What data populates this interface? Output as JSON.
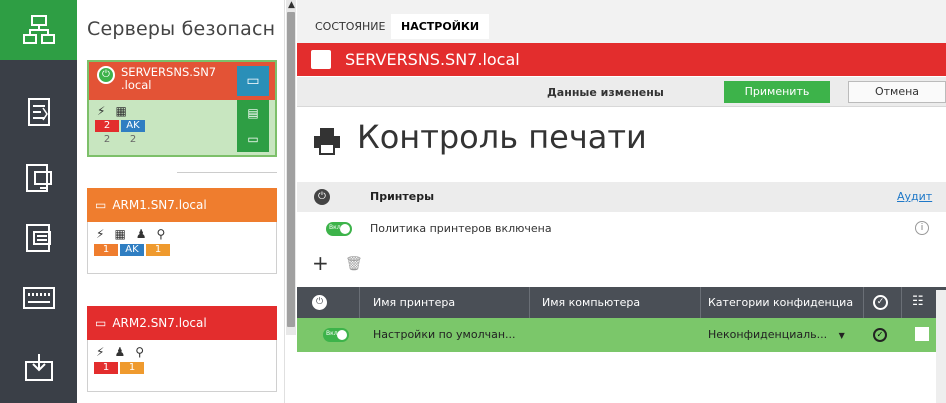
{
  "rail": {
    "items": [
      {
        "icon": "network-icon",
        "active": true
      },
      {
        "icon": "policy-icon",
        "active": false
      },
      {
        "icon": "devices-icon",
        "active": false
      },
      {
        "icon": "log-icon",
        "active": false
      },
      {
        "icon": "keyboard-icon",
        "active": false
      },
      {
        "icon": "install-icon",
        "active": false
      }
    ]
  },
  "tree": {
    "title": "Серверы безопасн",
    "cards": [
      {
        "name_line1": "SERVERSNS.SN7",
        "name_line2": ".local",
        "badges": [
          "2",
          "AK"
        ],
        "badges_row2": [
          "2",
          "2"
        ],
        "color": "#e35336"
      },
      {
        "name": "ARM1.SN7.local",
        "badges": [
          "1",
          "AK",
          "1"
        ],
        "color": "#ef7d2e"
      },
      {
        "name": "ARM2.SN7.local",
        "badges": [
          "1",
          "1"
        ],
        "color": "#e32d2d"
      }
    ]
  },
  "tabs": [
    {
      "label": "СОСТОЯНИЕ",
      "active": false
    },
    {
      "label": "НАСТРОЙКИ",
      "active": true
    }
  ],
  "server": {
    "name": "SERVERSNS.SN7.local"
  },
  "toolbar": {
    "changed_label": "Данные изменены",
    "apply_label": "Применить",
    "cancel_label": "Отмена"
  },
  "page": {
    "title": "Контроль печати"
  },
  "section": {
    "title": "Принтеры",
    "audit_link": "Аудит"
  },
  "policy": {
    "toggle_label": "Вкл",
    "text": "Политика принтеров включена"
  },
  "table": {
    "headers": [
      "Имя принтера",
      "Имя компьютера",
      "Категории конфиденциа"
    ],
    "rows": [
      {
        "toggle_label": "Вкл",
        "printer": "Настройки по умолчан...",
        "computer": "",
        "category": "Неконфиденциаль..."
      }
    ]
  },
  "colors": {
    "accent_green": "#3db34a",
    "header_red": "#e32d2d",
    "rail_bg": "#3a3f47"
  }
}
